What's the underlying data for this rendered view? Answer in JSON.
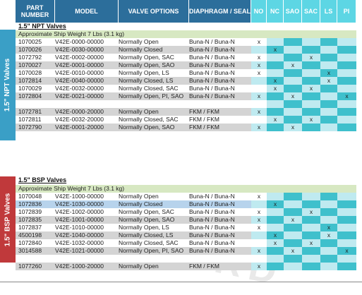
{
  "colors": {
    "header_dark": "#2c6e9b",
    "header_feature": "#5dd6e4",
    "npt_band": "#3a9fc6",
    "bsp_band": "#c0393b",
    "ship_row": "#d7e8c2",
    "row_light": "#ffffff",
    "row_dark": "#d4d4d4",
    "col_light": "#bfeaf0",
    "col_dark": "#3fc0cc",
    "selected": "#b7d3ec"
  },
  "headers": {
    "part_number": "PART NUMBER",
    "model": "MODEL",
    "valve_options": "VALVE OPTIONS",
    "diaphragm_seal": "DIAPHRAGM / SEAL",
    "no": "NO",
    "nc": "NC",
    "sao": "SAO",
    "sac": "SAC",
    "ls": "LS",
    "pi": "PI"
  },
  "watermark": "DWARD",
  "npt": {
    "side_label": "1.5\" NPT Valves",
    "title": "1.5\" NPT Valves",
    "ship_note": "Approximate Ship Weight 7 Lbs (3.1 kg)",
    "rows": [
      {
        "part": "1070025",
        "model": "V42E-0000-00000",
        "option": "Normally Open",
        "seal": "Buna-N / Buna-N",
        "marks": [
          1,
          0,
          0,
          0,
          0,
          0
        ]
      },
      {
        "part": "1070026",
        "model": "V42E-0030-00000",
        "option": "Normally Closed",
        "seal": "Buna-N / Buna-N",
        "marks": [
          0,
          1,
          0,
          0,
          0,
          0
        ]
      },
      {
        "part": "1072792",
        "model": "V42E-0002-00000",
        "option": "Normally Open, SAC",
        "seal": "Buna-N / Buna-N",
        "marks": [
          1,
          0,
          0,
          1,
          0,
          0
        ]
      },
      {
        "part": "1070027",
        "model": "V42E-0001-00000",
        "option": "Normally Open, SAO",
        "seal": "Buna-N / Buna-N",
        "marks": [
          1,
          0,
          1,
          0,
          0,
          0
        ]
      },
      {
        "part": "1070028",
        "model": "V42E-0010-00000",
        "option": "Normally Open, LS",
        "seal": "Buna-N / Buna-N",
        "marks": [
          1,
          0,
          0,
          0,
          1,
          0
        ]
      },
      {
        "part": "1072814",
        "model": "V42E-0040-00000",
        "option": "Normally Closed, LS",
        "seal": "Buna-N / Buna-N",
        "marks": [
          0,
          1,
          0,
          0,
          1,
          0
        ]
      },
      {
        "part": "1070029",
        "model": "V42E-0032-00000",
        "option": "Normally Closed, SAC",
        "seal": "Buna-N / Buna-N",
        "marks": [
          0,
          1,
          0,
          1,
          0,
          0
        ]
      },
      {
        "part": "1072804",
        "model": "V42E-0021-00000",
        "option": "Normally Open, PI, SAO",
        "seal": "Buna-N / Buna-N",
        "marks": [
          1,
          0,
          1,
          0,
          0,
          1
        ]
      },
      {
        "part": "",
        "model": "",
        "option": "",
        "seal": "",
        "marks": [
          0,
          0,
          0,
          0,
          0,
          0
        ]
      },
      {
        "part": "1072781",
        "model": "V42E-0000-20000",
        "option": "Normally Open",
        "seal": "FKM / FKM",
        "marks": [
          1,
          0,
          0,
          0,
          0,
          0
        ]
      },
      {
        "part": "1072811",
        "model": "V42E-0032-20000",
        "option": "Normally Closed, SAC",
        "seal": "FKM / FKM",
        "marks": [
          0,
          1,
          0,
          1,
          0,
          0
        ]
      },
      {
        "part": "1072790",
        "model": "V42E-0001-20000",
        "option": "Normally Open, SAO",
        "seal": "FKM / FKM",
        "marks": [
          1,
          0,
          1,
          0,
          0,
          0
        ]
      }
    ]
  },
  "bsp": {
    "side_label": "1.5\" BSP Valves",
    "title": "1.5\" BSP Valves",
    "ship_note": "Approximate Ship Weight 7 Lbs (3.1 kg)",
    "rows": [
      {
        "part": "1070048",
        "model": "V42E-1000-00000",
        "option": "Normally Open",
        "seal": "Buna-N / Buna-N",
        "marks": [
          1,
          0,
          0,
          0,
          0,
          0
        ]
      },
      {
        "part": "1072836",
        "model": "V42E-1030-00000",
        "option": "Normally Closed",
        "seal": "Buna-N / Buna-N",
        "marks": [
          0,
          1,
          0,
          0,
          0,
          0
        ],
        "selected": true
      },
      {
        "part": "1072839",
        "model": "V42E-1002-00000",
        "option": "Normally Open, SAC",
        "seal": "Buna-N / Buna-N",
        "marks": [
          1,
          0,
          0,
          1,
          0,
          0
        ]
      },
      {
        "part": "1072835",
        "model": "V42E-1001-00000",
        "option": "Normally Open, SAO",
        "seal": "Buna-N / Buna-N",
        "marks": [
          1,
          0,
          1,
          0,
          0,
          0
        ]
      },
      {
        "part": "1072837",
        "model": "V42E-1010-00000",
        "option": "Normally Open, LS",
        "seal": "Buna-N / Buna-N",
        "marks": [
          1,
          0,
          0,
          0,
          1,
          0
        ]
      },
      {
        "part": "4500198",
        "model": "V42E-1040-00000",
        "option": "Normally Closed, LS",
        "seal": "Buna-N / Buna-N",
        "marks": [
          0,
          1,
          0,
          0,
          1,
          0
        ]
      },
      {
        "part": "1072840",
        "model": "V42E-1032-00000",
        "option": "Normally Closed, SAC",
        "seal": "Buna-N / Buna-N",
        "marks": [
          0,
          1,
          0,
          1,
          0,
          0
        ]
      },
      {
        "part": "3014588",
        "model": "V42E-1021-00000",
        "option": "Normally Open, PI, SAO",
        "seal": "Buna-N / Buna-N",
        "marks": [
          1,
          0,
          1,
          0,
          0,
          1
        ]
      },
      {
        "part": "",
        "model": "",
        "option": "",
        "seal": "",
        "marks": [
          0,
          0,
          0,
          0,
          0,
          0
        ]
      },
      {
        "part": "1077260",
        "model": "V42E-1000-20000",
        "option": "Normally Open",
        "seal": "FKM / FKM",
        "marks": [
          1,
          0,
          0,
          0,
          0,
          0
        ]
      }
    ]
  },
  "mark_symbol": "x"
}
